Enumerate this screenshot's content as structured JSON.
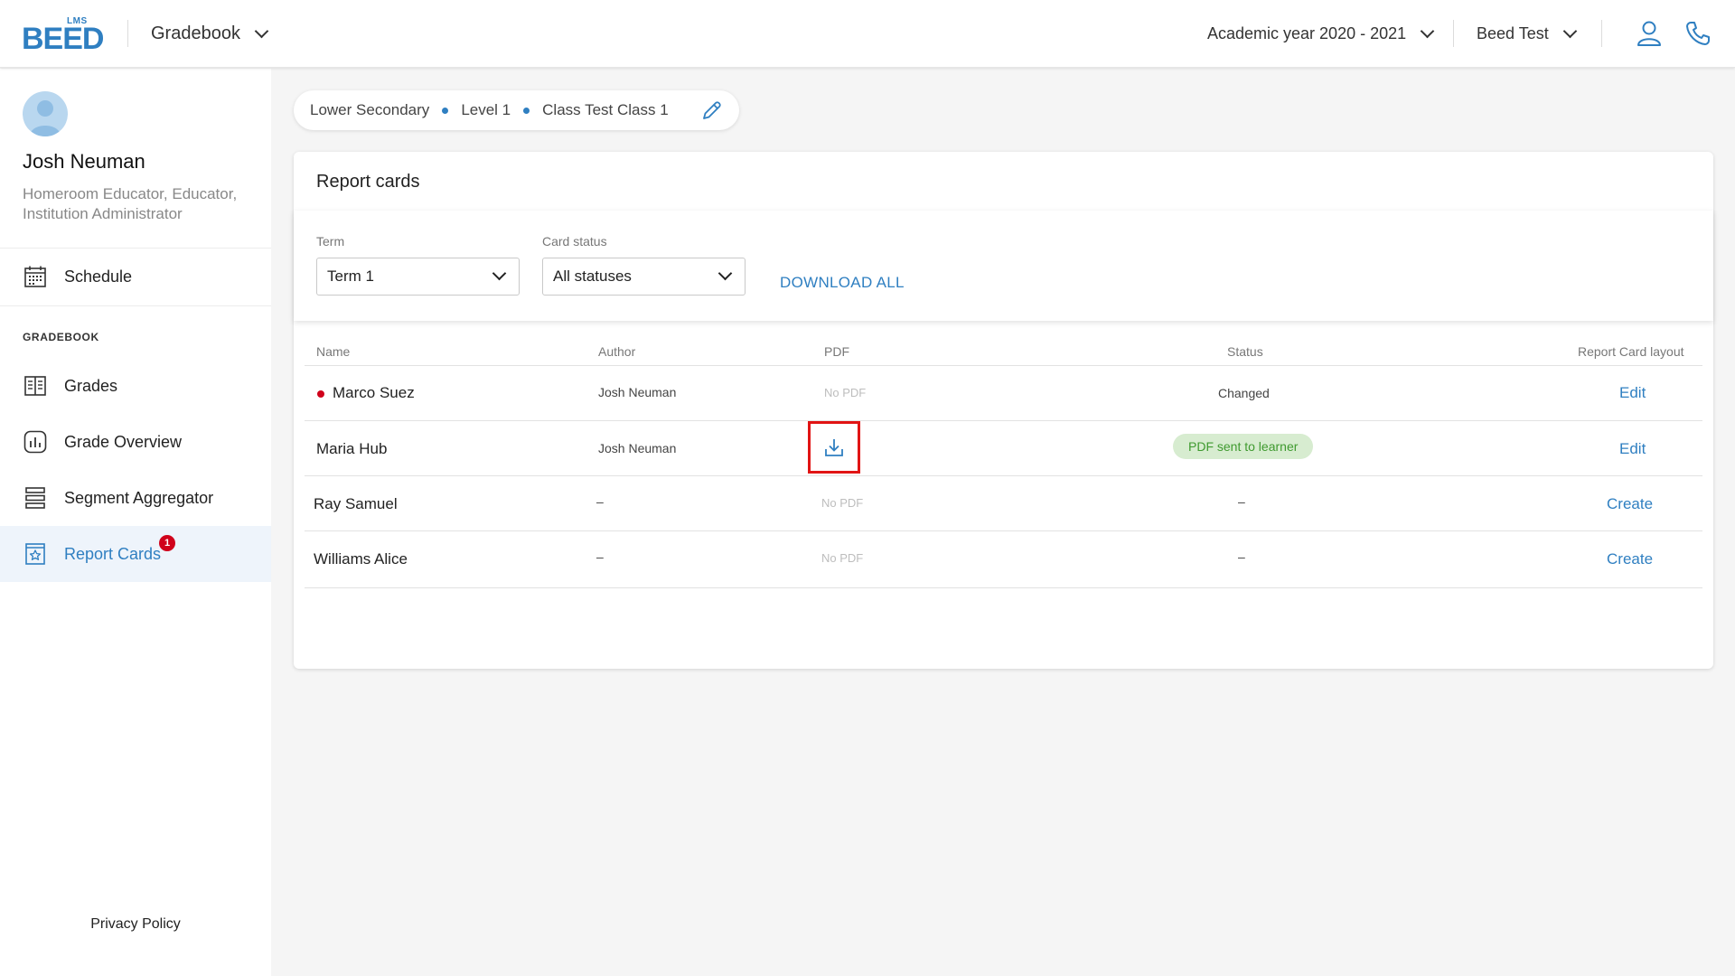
{
  "header": {
    "logo_lms": "LMS",
    "logo_text": "BEED",
    "module": "Gradebook",
    "academic_year": "Academic year 2020 - 2021",
    "institution": "Beed Test",
    "icons": [
      "user-icon",
      "phone-icon",
      "chevron-down-icon"
    ]
  },
  "profile": {
    "name": "Josh Neuman",
    "roles": "Homeroom Educator, Educator, Institution Administrator"
  },
  "sidebar": {
    "schedule": "Schedule",
    "section_title": "GRADEBOOK",
    "items": [
      {
        "label": "Grades",
        "icon": "book-icon"
      },
      {
        "label": "Grade Overview",
        "icon": "chart-icon"
      },
      {
        "label": "Segment Aggregator",
        "icon": "layers-icon"
      },
      {
        "label": "Report Cards",
        "icon": "report-card-icon",
        "badge": "1",
        "active": true
      }
    ],
    "privacy": "Privacy Policy"
  },
  "breadcrumb": [
    "Lower Secondary",
    "Level 1",
    "Class Test Class 1"
  ],
  "card": {
    "title": "Report cards",
    "filters": {
      "term_label": "Term",
      "term_value": "Term 1",
      "status_label": "Card status",
      "status_value": "All statuses",
      "download_all": "DOWNLOAD ALL"
    },
    "columns": {
      "name": "Name",
      "author": "Author",
      "pdf": "PDF",
      "status": "Status",
      "layout": "Report Card layout"
    },
    "rows": [
      {
        "name": "Marco Suez",
        "author": "Josh Neuman",
        "pdf": "No PDF",
        "status": "Changed",
        "action": "Edit"
      },
      {
        "name": "Maria Hub",
        "author": "Josh Neuman",
        "pdf": "",
        "status": "PDF sent to learner",
        "action": "Edit"
      },
      {
        "name": "Ray Samuel",
        "author": "–",
        "pdf": "No PDF",
        "status": "–",
        "action": "Create"
      },
      {
        "name": "Williams Alice",
        "author": "–",
        "pdf": "No PDF",
        "status": "–",
        "action": "Create"
      }
    ]
  },
  "colors": {
    "accent": "#2f7fc1",
    "alert": "#d0021b",
    "success_bg": "#d7ecd0",
    "success_text": "#3f9a2f",
    "highlight": "#e11414"
  }
}
